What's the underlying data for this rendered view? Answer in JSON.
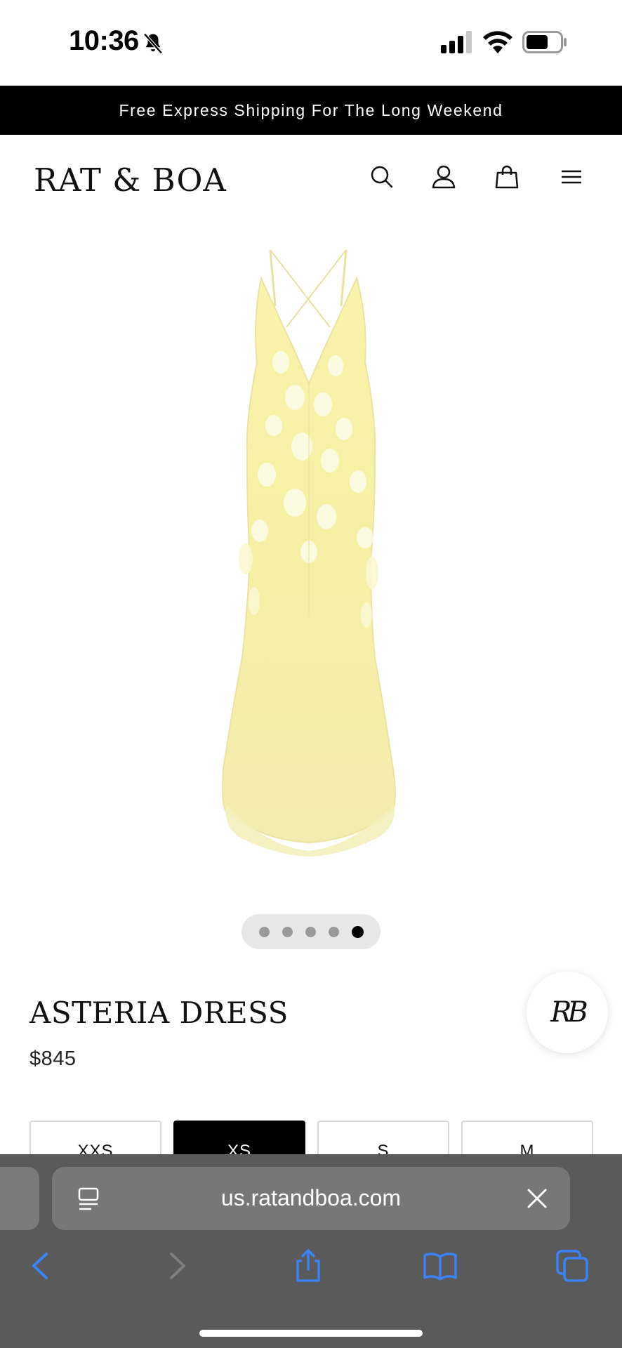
{
  "status_bar": {
    "time": "10:36"
  },
  "announcement": {
    "text": "Free Express Shipping For The Long Weekend"
  },
  "header": {
    "logo": "RAT & BOA"
  },
  "carousel": {
    "total": 5,
    "active_index": 4
  },
  "product": {
    "title": "ASTERIA DRESS",
    "price": "$845",
    "dress_color": "#f5f0a6",
    "sizes": [
      {
        "label": "XXS",
        "selected": false
      },
      {
        "label": "XS",
        "selected": true
      },
      {
        "label": "S",
        "selected": false
      },
      {
        "label": "M",
        "selected": false
      }
    ]
  },
  "chat_badge": {
    "label": "RB"
  },
  "browser": {
    "url": "us.ratandboa.com",
    "accent": "#3b82f6"
  },
  "icons": [
    "bell-slash-icon",
    "signal-icon",
    "wifi-icon",
    "battery-icon",
    "search-icon",
    "account-icon",
    "bag-icon",
    "menu-icon",
    "page-menu-icon",
    "clear-icon",
    "back-icon",
    "forward-icon",
    "share-icon",
    "bookmarks-icon",
    "tabs-icon"
  ]
}
